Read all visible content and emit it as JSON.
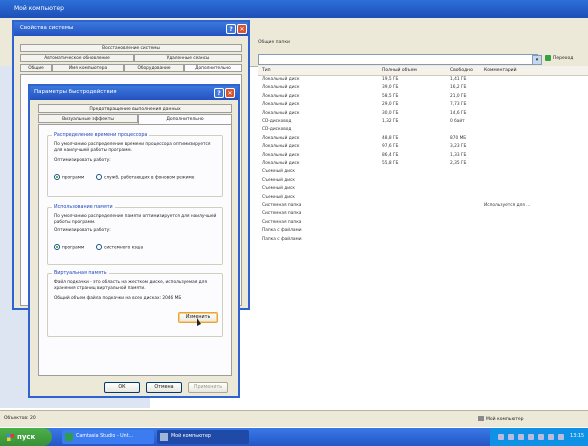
{
  "explorer": {
    "title": "Мой компьютер",
    "toolbar_text": "Общие папки",
    "goto_label": "Переход",
    "columns": [
      "Тип",
      "Полный объем",
      "Свободно",
      "Комментарий"
    ],
    "rows": [
      {
        "type": "Локальный диск",
        "total": "19,5 ГБ",
        "free": "1,41 ГБ",
        "comment": ""
      },
      {
        "type": "Локальный диск",
        "total": "39,0 ГБ",
        "free": "16,2 ГБ",
        "comment": ""
      },
      {
        "type": "Локальный диск",
        "total": "58,5 ГБ",
        "free": "21,0 ГБ",
        "comment": ""
      },
      {
        "type": "Локальный диск",
        "total": "29,0 ГБ",
        "free": "7,73 ГБ",
        "comment": ""
      },
      {
        "type": "Локальный диск",
        "total": "30,0 ГБ",
        "free": "14,6 ГБ",
        "comment": ""
      },
      {
        "type": "CD-дисковод",
        "total": "1,32 ГБ",
        "free": "0 байт",
        "comment": ""
      },
      {
        "type": "CD-дисковод",
        "total": "",
        "free": "",
        "comment": ""
      },
      {
        "type": "Локальный диск",
        "total": "48,8 ГБ",
        "free": "870 МБ",
        "comment": ""
      },
      {
        "type": "Локальный диск",
        "total": "97,6 ГБ",
        "free": "3,23 ГБ",
        "comment": ""
      },
      {
        "type": "Локальный диск",
        "total": "86,4 ГБ",
        "free": "1,33 ГБ",
        "comment": ""
      },
      {
        "type": "Локальный диск",
        "total": "55,8 ГБ",
        "free": "2,35 ГБ",
        "comment": ""
      },
      {
        "type": "Съемный диск",
        "total": "",
        "free": "",
        "comment": ""
      },
      {
        "type": "Съемный диск",
        "total": "",
        "free": "",
        "comment": ""
      },
      {
        "type": "Съемный диск",
        "total": "",
        "free": "",
        "comment": ""
      },
      {
        "type": "Съемный диск",
        "total": "",
        "free": "",
        "comment": ""
      },
      {
        "type": "Системная папка",
        "total": "",
        "free": "",
        "comment": "Используется для ..."
      },
      {
        "type": "Системная папка",
        "total": "",
        "free": "",
        "comment": ""
      },
      {
        "type": "Системная папка",
        "total": "",
        "free": "",
        "comment": ""
      },
      {
        "type": "Папка с файлами",
        "total": "",
        "free": "",
        "comment": ""
      },
      {
        "type": "Папка с файлами",
        "total": "",
        "free": "",
        "comment": ""
      }
    ],
    "status_left": "Объектов: 20",
    "status_right": "Мой компьютер"
  },
  "system_properties": {
    "title": "Свойства системы",
    "tabs_row1": [
      "Восстановление системы"
    ],
    "tabs_row2": [
      "Автоматическое обновление",
      "Удаленные сеансы"
    ],
    "tabs_row3": [
      "Общие",
      "Имя компьютера",
      "Оборудование",
      "Дополнительно"
    ]
  },
  "performance_options": {
    "title": "Параметры быстродействия",
    "tab_top": "Предотвращение выполнения данных",
    "tabs": [
      "Визуальные эффекты",
      "Дополнительно"
    ],
    "cpu_group": {
      "title": "Распределение времени процессора",
      "text": "По умолчанию распределение времени процессора оптимизируется для наилучшей работы программ.",
      "optimize_label": "Оптимизировать работу:",
      "opt1": "программ",
      "opt2": "служб, работающих в фоновом режиме"
    },
    "mem_group": {
      "title": "Использование памяти",
      "text": "По умолчанию распределение памяти оптимизируется для наилучшей работы программ.",
      "optimize_label": "Оптимизировать работу:",
      "opt1": "программ",
      "opt2": "системного кэша"
    },
    "vm_group": {
      "title": "Виртуальная память",
      "text": "Файл подкачки - это область на жестком диске, используемая для хранения страниц виртуальной памяти.",
      "total": "Общий объем файла подкачки на всех дисках: 2046 МБ",
      "change_button": "Изменить"
    },
    "ok": "ОК",
    "cancel": "Отмена",
    "apply": "Применить"
  },
  "taskbar": {
    "start": "пуск",
    "task1": "Camtasia Studio - Unt...",
    "task2": "Мой компьютер",
    "clock": "13:15"
  }
}
